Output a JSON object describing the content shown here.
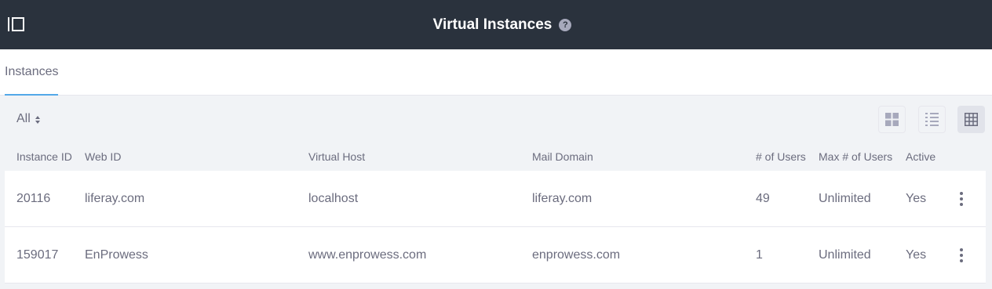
{
  "header": {
    "title": "Virtual Instances",
    "help_glyph": "?",
    "sidebar_toggle_icon": "sidebar-toggle-icon",
    "help_icon": "question-circle-icon"
  },
  "tabs": [
    {
      "label": "Instances",
      "active": true
    }
  ],
  "toolbar": {
    "filter_label": "All",
    "view_modes": [
      {
        "name": "cards",
        "icon": "cards-view-icon",
        "active": false
      },
      {
        "name": "list",
        "icon": "list-view-icon",
        "active": false
      },
      {
        "name": "table",
        "icon": "table-view-icon",
        "active": true
      }
    ]
  },
  "table": {
    "columns": [
      "Instance ID",
      "Web ID",
      "Virtual Host",
      "Mail Domain",
      "# of Users",
      "Max # of Users",
      "Active"
    ],
    "rows": [
      {
        "instance_id": "20116",
        "web_id": "liferay.com",
        "virtual_host": "localhost",
        "mail_domain": "liferay.com",
        "users": "49",
        "max_users": "Unlimited",
        "active": "Yes"
      },
      {
        "instance_id": "159017",
        "web_id": "EnProwess",
        "virtual_host": "www.enprowess.com",
        "mail_domain": "enprowess.com",
        "users": "1",
        "max_users": "Unlimited",
        "active": "Yes"
      }
    ]
  },
  "colors": {
    "header_bg": "#2a323d",
    "page_bg": "#f1f3f6",
    "text": "#6b6c7e",
    "accent": "#53a8e8"
  }
}
